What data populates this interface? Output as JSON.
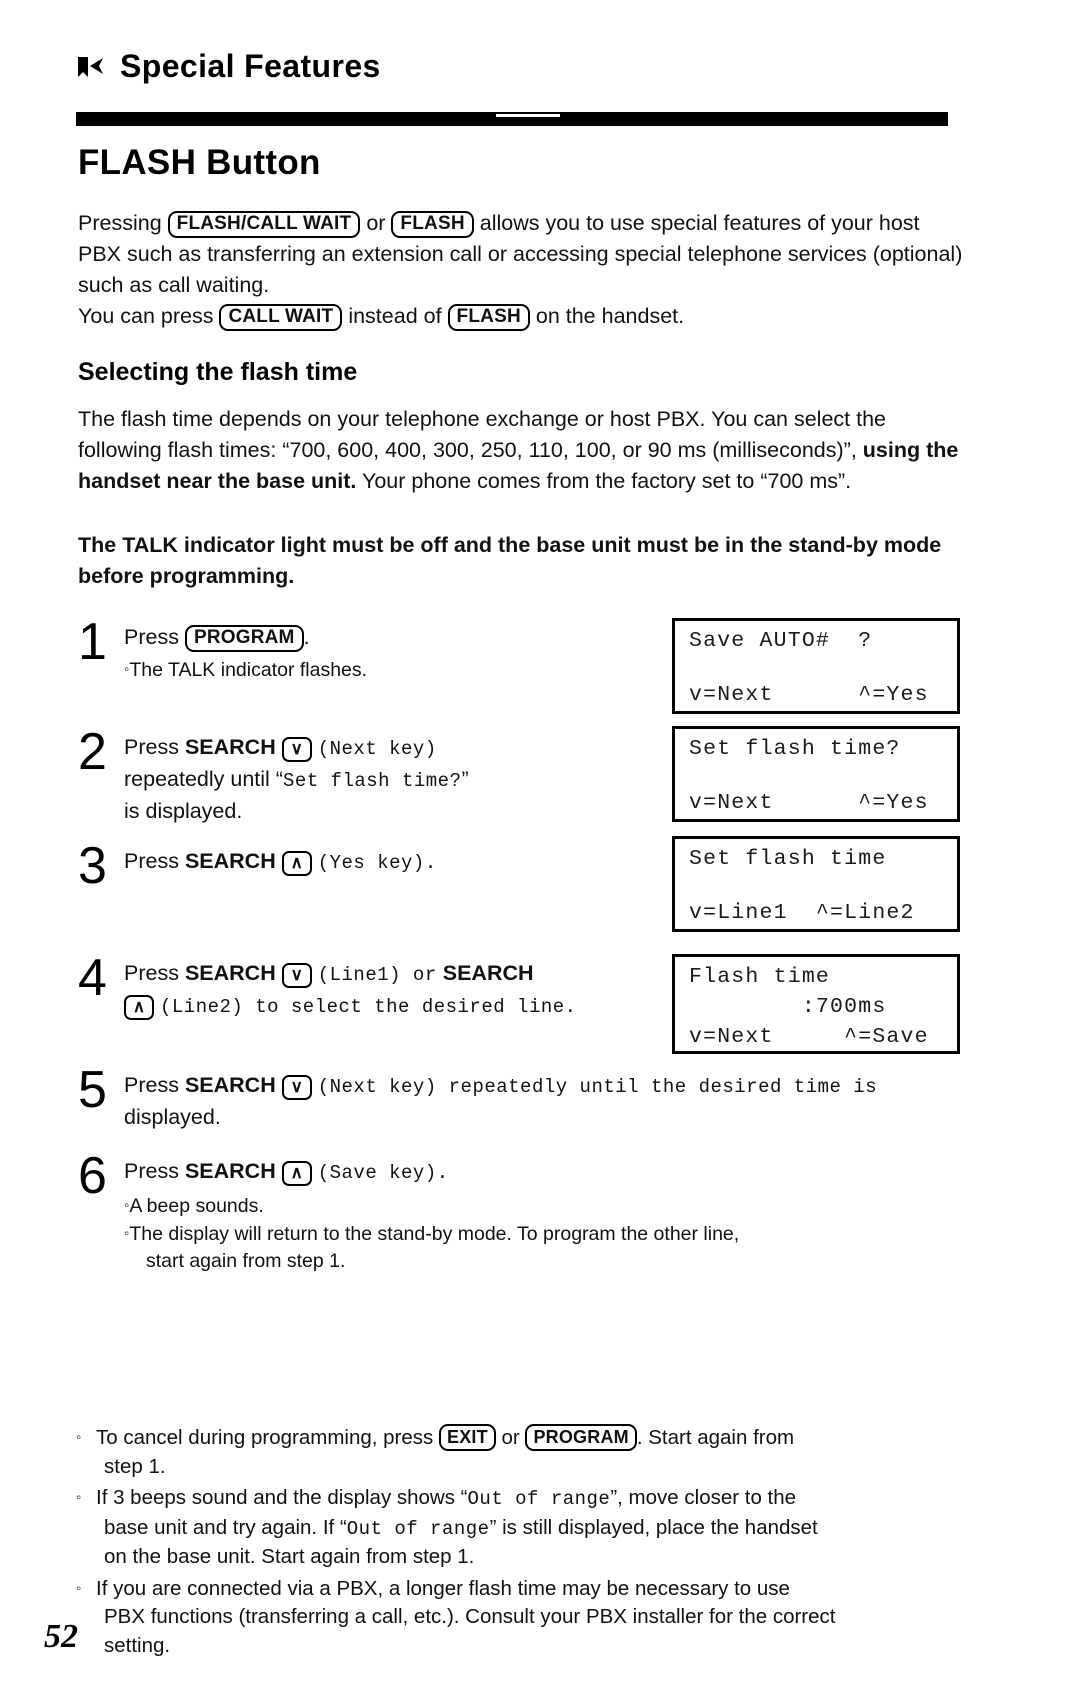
{
  "header": {
    "icon": "bookmark-arrow-icon",
    "title": "Special Features"
  },
  "section": {
    "title": "FLASH Button",
    "intro_1": "Pressing",
    "key_flash_call_wait": "FLASH/CALL WAIT",
    "intro_or": "or",
    "key_flash": "FLASH",
    "intro_2": "allows you to use special features of your host PBX such as transferring an extension call or accessing special telephone services (optional) such as call waiting.",
    "intro_3": "You can press",
    "key_call_wait": "CALL WAIT",
    "intro_4": "instead of",
    "key_flash_2": "FLASH",
    "intro_5": "on the handset."
  },
  "subsection": {
    "title": "Selecting the flash time",
    "para_1": "The flash time depends on your telephone exchange or host PBX. You can select the following flash times: “700, 600, 400, 300, 250, 110, 100, or 90 ms (milliseconds)”,",
    "para_1_bold": "using the handset near the base unit.",
    "para_1_tail": "Your phone comes from the factory set to “700 ms”.",
    "para_2_bold": "The TALK indicator light must be off and the base unit must be in the stand-by mode before programming."
  },
  "steps": [
    {
      "num": "1",
      "text_pre": "Press",
      "key": "PROGRAM",
      "text_post": ".",
      "bullets": [
        "The TALK indicator flashes."
      ]
    },
    {
      "num": "2",
      "text_pre": "Press",
      "bold": "SEARCH",
      "arrow": "∨",
      "paren": "(Next key)",
      "line2_pre": "repeatedly until “",
      "line2_mono": "Set flash time?",
      "line2_post": "”",
      "line3": "is displayed."
    },
    {
      "num": "3",
      "text_pre": "Press",
      "bold": "SEARCH",
      "arrow": "∧",
      "paren": "(Yes key)."
    },
    {
      "num": "4",
      "text_pre": "Press",
      "bold": "SEARCH",
      "arrow": "∨",
      "paren": "(Line1) or",
      "bold2": "SEARCH",
      "arrow2": "∧",
      "paren2": "(Line2) to select the desired line."
    },
    {
      "num": "5",
      "text_pre": "Press",
      "bold": "SEARCH",
      "arrow": "∨",
      "paren": "(Next key) repeatedly until the desired time is",
      "line2": "displayed."
    },
    {
      "num": "6",
      "text_pre": "Press",
      "bold": "SEARCH",
      "arrow": "∧",
      "paren": "(Save key).",
      "bullets": [
        "A beep sounds.",
        "The display will return to the stand-by mode. To program the other line,",
        "start again from step 1."
      ]
    }
  ],
  "displays": [
    {
      "name": "display-step1",
      "line1": "Save AUTO#  ?",
      "line2": "",
      "line3": "v=Next      ^=Yes"
    },
    {
      "name": "display-step2",
      "line1": "Set flash time?",
      "line2": "",
      "line3": "v=Next      ^=Yes"
    },
    {
      "name": "display-step3",
      "line1": "Set flash time",
      "line2": "",
      "line3": "v=Line1  ^=Line2"
    },
    {
      "name": "display-step4",
      "line1": "Flash time",
      "line2": "        :700ms",
      "line3": "v=Next     ^=Save"
    }
  ],
  "notes": [
    {
      "l1_pre": "To cancel during programming, press",
      "key1": "EXIT",
      "mid": "or",
      "key2": "PROGRAM",
      "l1_post": ". Start again from",
      "l2": "step 1."
    },
    {
      "l1_pre": "If 3 beeps sound and the display shows “",
      "mono1": "Out of range",
      "l1_mid": "”, move closer to the",
      "l2_pre": "base unit and try again. If “",
      "mono2": "Out of range",
      "l2_post": "” is still displayed, place the handset",
      "l3": "on the base unit. Start again from step 1."
    },
    {
      "l1": "If you are connected via a PBX, a longer flash time may be necessary to use",
      "l2": "PBX functions (transferring a call, etc.). Consult your PBX installer for the correct",
      "l3": "setting."
    }
  ],
  "page_number": "52"
}
